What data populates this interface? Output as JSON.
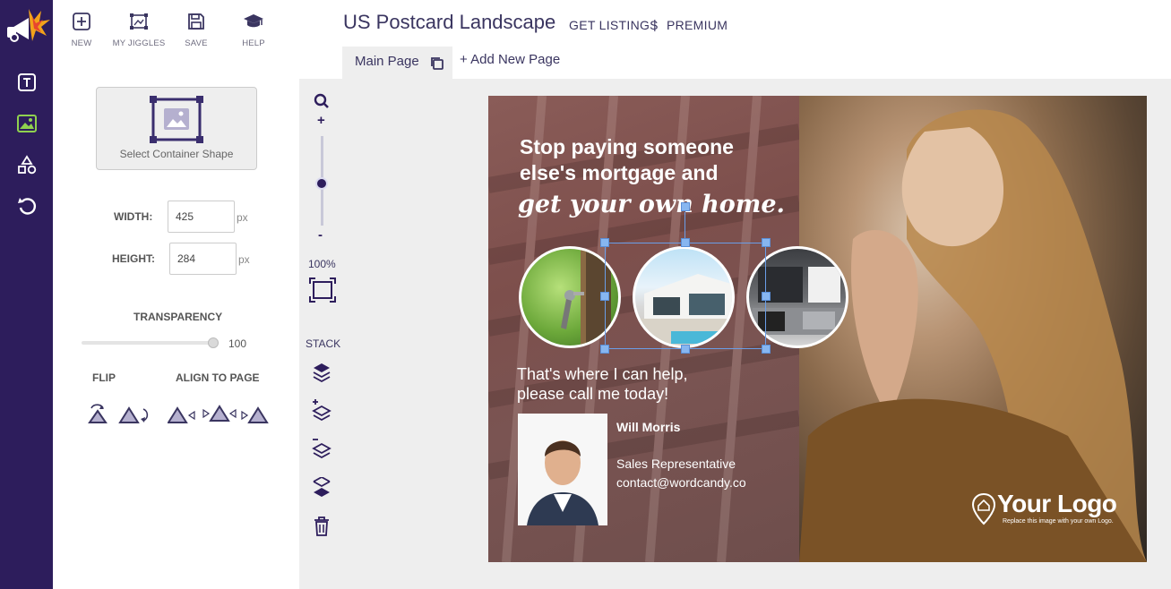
{
  "toolbar": {
    "new_label": "NEW",
    "jiggles_label": "MY JIGGLES",
    "save_label": "SAVE",
    "help_label": "HELP"
  },
  "header": {
    "title": "US Postcard Landscape",
    "get_listings": "GET LISTINGS",
    "separator": "|",
    "premium": "PREMIUM"
  },
  "tabs": {
    "main_page": "Main Page",
    "add_new_page": "+ Add New Page"
  },
  "left_panel": {
    "container_caption": "Select Container Shape",
    "width_label": "WIDTH:",
    "width_value": "425",
    "height_label": "HEIGHT:",
    "height_value": "284",
    "unit": "px",
    "transparency_label": "TRANSPARENCY",
    "transparency_value": "100",
    "flip_label": "FLIP",
    "align_label": "ALIGN TO PAGE"
  },
  "vertical_tools": {
    "zoom_in": "+",
    "zoom_out": "-",
    "zoom_level": "100%",
    "stack_label": "STACK"
  },
  "postcard": {
    "headline": "Stop paying someone else's mortgage and",
    "script_line": "get your own home.",
    "help_text_1": "That's where I can help,",
    "help_text_2": "please call me today!",
    "agent_name": "Will Morris",
    "agent_role": "Sales Representative",
    "agent_email": "contact@wordcandy.co",
    "logo_text": "Your Logo",
    "logo_sub": "Replace this image with your own Logo."
  },
  "colors": {
    "rail": "#2d1d5c",
    "accent": "#3a3560",
    "panel_brown": "#7d4f4c"
  }
}
